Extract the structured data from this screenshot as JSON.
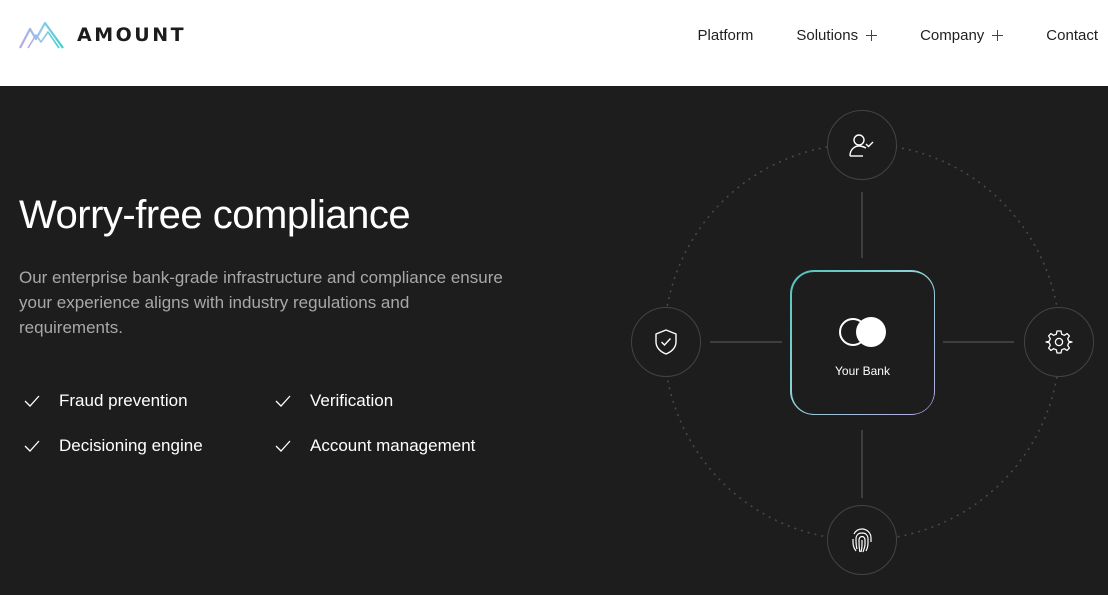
{
  "header": {
    "logo_text": "AMOUNT",
    "nav": [
      {
        "label": "Platform",
        "has_expand": false
      },
      {
        "label": "Solutions",
        "has_expand": true
      },
      {
        "label": "Company",
        "has_expand": true
      },
      {
        "label": "Contact",
        "has_expand": false
      }
    ]
  },
  "hero": {
    "title": "Worry-free compliance",
    "description": "Our enterprise bank-grade infrastructure and compliance ensure your experience aligns with industry regulations and requirements.",
    "features": [
      {
        "label": "Fraud prevention",
        "icon": "check-icon"
      },
      {
        "label": "Verification",
        "icon": "check-icon"
      },
      {
        "label": "Decisioning engine",
        "icon": "check-icon"
      },
      {
        "label": "Account management",
        "icon": "check-icon"
      }
    ]
  },
  "diagram": {
    "center_label": "Your Bank",
    "nodes": {
      "top": "user-check-icon",
      "left": "shield-check-icon",
      "right": "gear-icon",
      "bottom": "fingerprint-icon"
    }
  },
  "colors": {
    "background_dark": "#1d1d1d",
    "header_bg": "#ffffff",
    "accent_teal": "#4fc3c0",
    "accent_lavender": "#b8a6e3",
    "muted_text": "#a8a8a8"
  }
}
